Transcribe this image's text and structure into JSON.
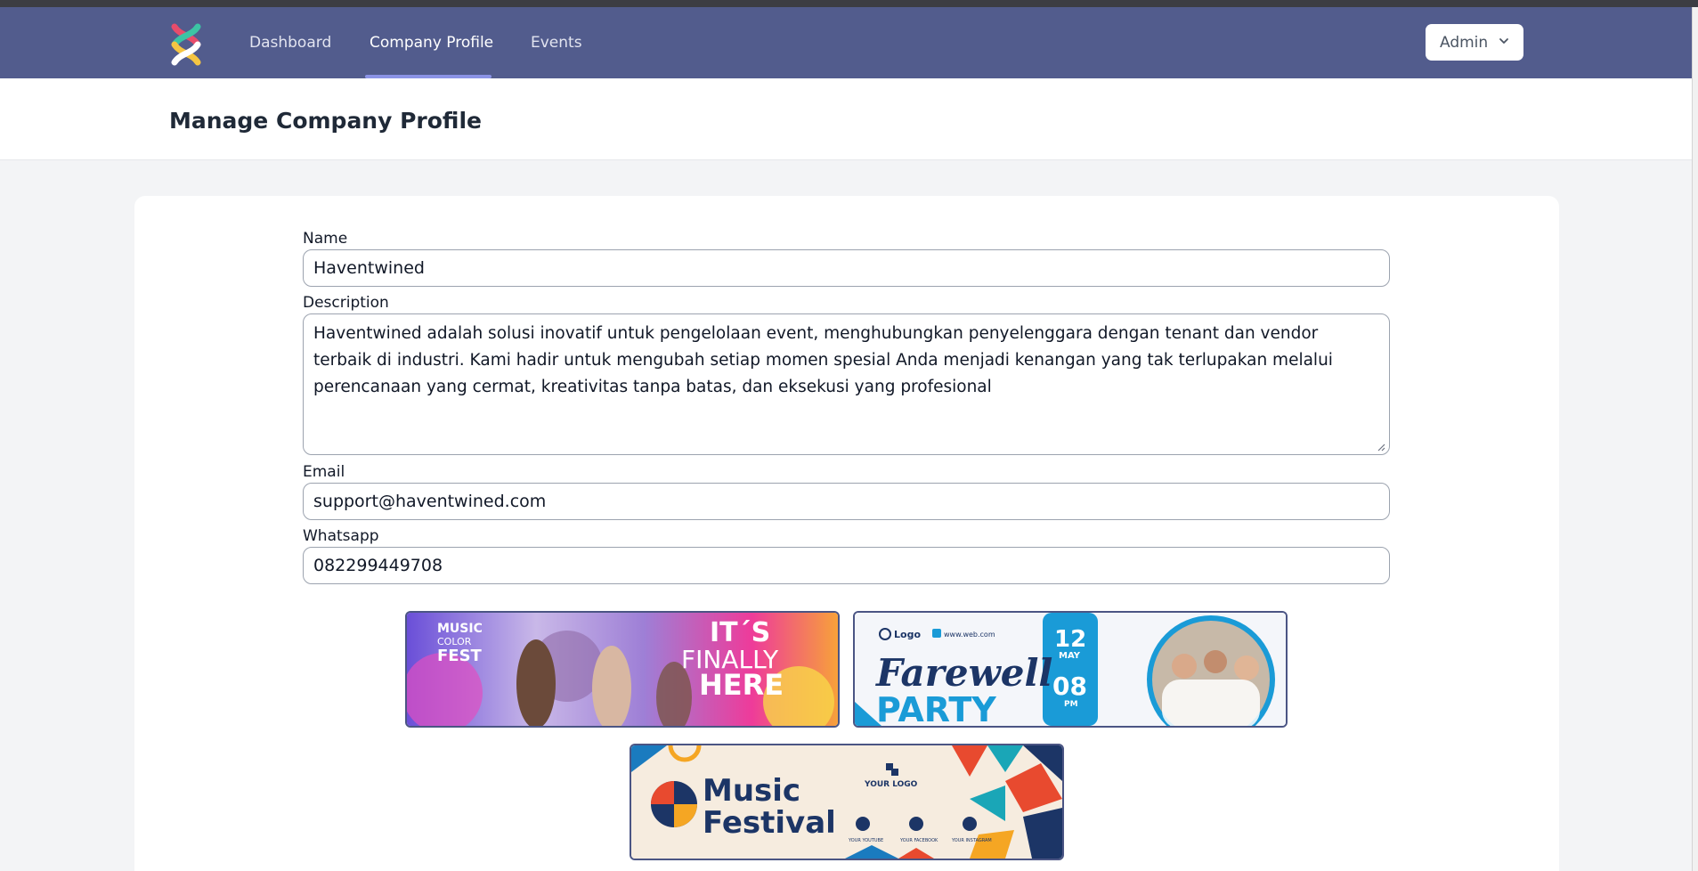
{
  "nav": {
    "links": [
      {
        "label": "Dashboard"
      },
      {
        "label": "Company Profile"
      },
      {
        "label": "Events"
      }
    ],
    "admin_label": "Admin",
    "active_color": "#8b93e6",
    "bar_color": "#525c8d"
  },
  "header": {
    "title": "Manage Company Profile"
  },
  "form": {
    "name_label": "Name",
    "name_value": "Haventwined",
    "description_label": "Description",
    "description_value": "Haventwined adalah solusi inovatif untuk pengelolaan event, menghubungkan penyelenggara dengan tenant dan vendor terbaik di industri. Kami hadir untuk mengubah setiap momen spesial Anda menjadi kenangan yang tak terlupakan melalui perencanaan yang cermat, kreativitas tanpa batas, dan eksekusi yang profesional",
    "email_label": "Email",
    "email_value": "support@haventwined.com",
    "whatsapp_label": "Whatsapp",
    "whatsapp_value": "082299449708"
  },
  "banners": {
    "music_color_fest": {
      "line1": "MUSIC",
      "line2": "COLOR",
      "line3": "FEST",
      "headline1": "IT´S",
      "headline2": "FINALLY",
      "headline3": "HERE"
    },
    "farewell_party": {
      "logo": "Logo",
      "web": "www.web.com",
      "title1": "Farewell",
      "title2": "PARTY",
      "day": "12",
      "month": "MAY",
      "time": "08",
      "ampm": "PM"
    },
    "music_festival": {
      "title1": "Music",
      "title2": "Festival",
      "logo_text": "YOUR LOGO",
      "social1": "YOUR YOUTUBE",
      "social2": "YOUR FACEBOOK",
      "social3": "YOUR INSTAGRAM"
    }
  }
}
